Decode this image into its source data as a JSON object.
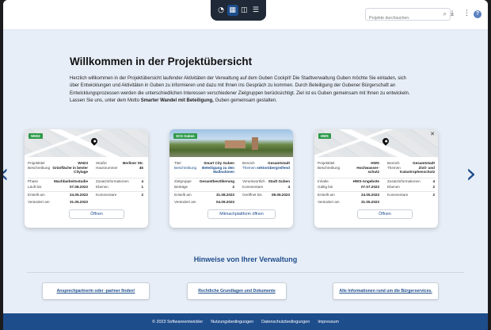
{
  "view_toggle": {
    "icons": [
      "dashboard-icon",
      "grid-icon",
      "map-icon",
      "list-icon"
    ],
    "active": "grid-icon"
  },
  "search": {
    "placeholder": "Projekte durchsuchen"
  },
  "heading": "Willkommen in der Projektübersicht",
  "intro": {
    "text_1": "Herzlich willkommen in der Projektübersicht laufender Aktivitäten der Verwaltung auf dem Guben Cockpit! Die Stadtverwaltung Guben möchte Sie einladen, sich über Entwicklungen und Aktivitäten in Guben zu informieren und dazu mit Ihnen ins Gespräch zu kommen. Durch Beteiligung der Gubener Bürgerschaft an Entwicklungsprozessen werden die unterschiedlichen Interessen verschiedener Zielgruppen berücksichtigt. Ziel ist es Guben gemeinsam mit Ihnen zu entwickeln. Lassen Sie uns, unter dem Motto ",
    "motto": "Smarter Wandel mit Beteiligung,",
    "text_2": " Guben gemeinsam gestalten."
  },
  "cards": [
    {
      "badge": "WH23",
      "fields": {
        "projekttitel_label": "Projekttitel",
        "projekttitel": "WH23",
        "strasse_label": "Straße",
        "strasse": "Berliner Str.",
        "beschreibung_label": "Beschreibung",
        "beschreibung": "Grünfläche in bester Citylage",
        "hausnummer_label": "Hausnummer",
        "hausnummer": "45",
        "phase_label": "Phase",
        "phase": "Machbarkeitsstudie",
        "zusatz_label": "Zusatzinformationen",
        "zusatz": "4",
        "laeuft_label": "Läuft bis",
        "laeuft": "07.08.2023",
        "ebenen_label": "Ebenen",
        "ebenen": "1",
        "erstellt_label": "Erstellt am",
        "erstellt": "24.05.2023",
        "kommentare_label": "Kommentare",
        "kommentare": "2",
        "veraendert_label": "Verändert am",
        "veraendert": "31.05.2023"
      },
      "button": "Öffnen"
    },
    {
      "badge": "SCG Guben",
      "fields": {
        "titel_label": "Titel",
        "titel": "Smart City Guben",
        "bereich_label": "Bereich",
        "bereich": "Gesamtstadt",
        "beschreibung_label": "Beschreibung",
        "beschreibung": "Beteiligung zu den Maßnahmen",
        "themen_label": "Themen",
        "themen": "sektorübergreifend",
        "zielgruppe_label": "Zielgruppe",
        "zielgruppe": "Gesamtbevölkerung",
        "verantwortlich_label": "Verantwortlich",
        "verantwortlich": "Stadt Guben",
        "beitraege_label": "Beiträge",
        "beitraege": "2",
        "kommentare_label": "Kommentare",
        "kommentare": "4",
        "erstellt_label": "Erstellt am",
        "erstellt": "31.08.2023",
        "geoeffnet_label": "Geöffnet bis",
        "geoeffnet": "08.09.2023",
        "veraendert_label": "Verändert am",
        "veraendert": "04.09.2023"
      },
      "button": "Mitmachplattform öffnen"
    },
    {
      "badge": "HWS",
      "fields": {
        "projekttitel_label": "Projekttitel",
        "projekttitel": "HWS",
        "bereich_label": "Bereich",
        "bereich": "Gesamtstadt",
        "beschreibung_label": "Beschreibung",
        "beschreibung": "Hochwasser-schutz",
        "themen_label": "Themen",
        "themen": "Zivil- und Katastrophenschutz",
        "inhalte_label": "Inhalte",
        "inhalte": "HWS-Angebote",
        "zusatz_label": "Zusatzinformationen",
        "zusatz": "4",
        "gueltig_label": "Gültig bis",
        "gueltig": "07.07.2023",
        "ebenen_label": "Ebenen",
        "ebenen": "2",
        "erstellt_label": "Erstellt am",
        "erstellt": "24.05.2023",
        "kommentare_label": "Kommentare",
        "kommentare": "2",
        "veraendert_label": "Verändert am",
        "veraendert": "31.05.2023"
      },
      "button": "Öffnen"
    }
  ],
  "hints": {
    "title": "Hinweise von Ihrer Verwaltung",
    "buttons": [
      "Ansprechpartnerin oder -partner finden!",
      "Rechtliche Grundlagen und Dokumente",
      "Alle Informationen rund um die Bürgerservices."
    ]
  },
  "footer": {
    "copyright": "© 2023 Softwareentwickler",
    "links": [
      "Nutzungsbedingungen",
      "Datenschutzbedingungen",
      "Impressum"
    ]
  },
  "colors": {
    "brand": "#1e4d8c",
    "page_bg": "#e8eef7",
    "badge": "#2e9a4a"
  }
}
